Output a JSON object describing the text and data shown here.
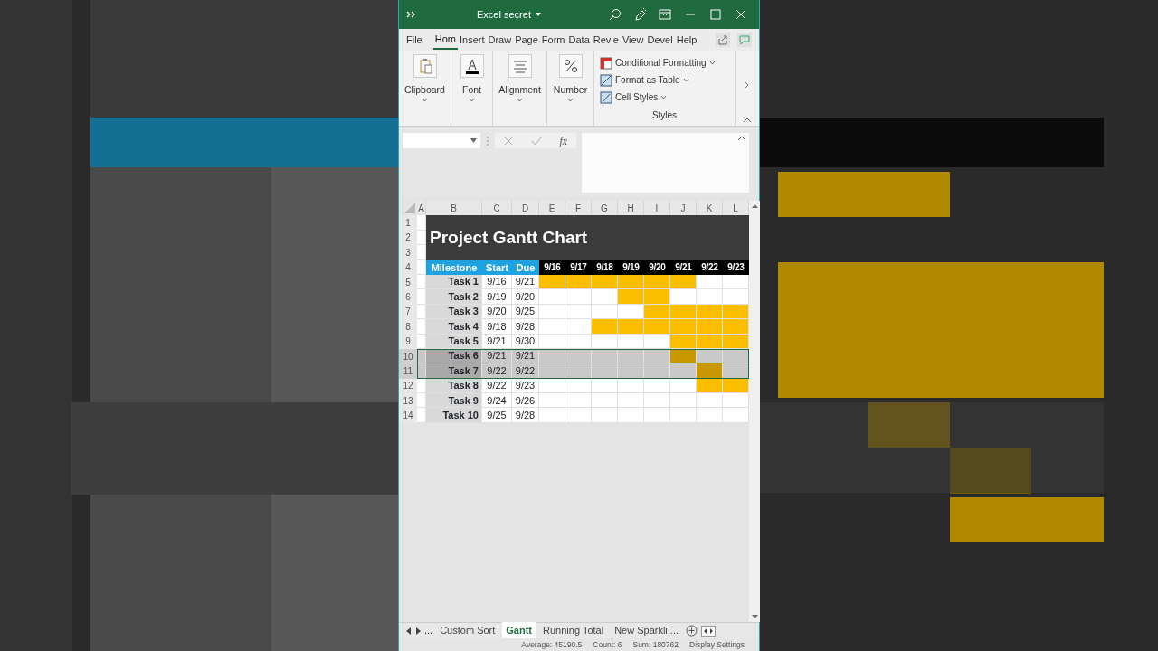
{
  "window": {
    "title": "Excel secret"
  },
  "menu_tabs": [
    {
      "label": "File",
      "selected": false
    },
    {
      "label": "Hom",
      "selected": true
    },
    {
      "label": "Insert",
      "selected": false
    },
    {
      "label": "Draw",
      "selected": false
    },
    {
      "label": "Page",
      "selected": false
    },
    {
      "label": "Form",
      "selected": false
    },
    {
      "label": "Data",
      "selected": false
    },
    {
      "label": "Revie",
      "selected": false
    },
    {
      "label": "View",
      "selected": false
    },
    {
      "label": "Devel",
      "selected": false
    },
    {
      "label": "Help",
      "selected": false
    }
  ],
  "ribbon_groups": [
    {
      "label": "Clipboard"
    },
    {
      "label": "Font"
    },
    {
      "label": "Alignment"
    },
    {
      "label": "Number"
    }
  ],
  "styles_group": {
    "label": "Styles",
    "items": [
      "Conditional Formatting",
      "Format as Table",
      "Cell Styles"
    ]
  },
  "formula_bar": {
    "function_label": "fx"
  },
  "sheet": {
    "column_headers": [
      "A",
      "B",
      "C",
      "D",
      "E",
      "F",
      "G",
      "H",
      "I",
      "J",
      "K",
      "L"
    ],
    "top_row_numbers": [
      "1",
      "2",
      "3",
      "4"
    ],
    "title": "Project Gantt Chart",
    "table_headers": [
      "Milestone",
      "Start",
      "Due"
    ],
    "dates": [
      "9/16",
      "9/17",
      "9/18",
      "9/19",
      "9/20",
      "9/21",
      "9/22",
      "9/23"
    ],
    "rows": [
      {
        "row_number": "5",
        "task": "Task 1",
        "start": "9/16",
        "due": "9/21",
        "selected": false,
        "bars": [
          true,
          true,
          true,
          true,
          true,
          true,
          false,
          false
        ]
      },
      {
        "row_number": "6",
        "task": "Task 2",
        "start": "9/19",
        "due": "9/20",
        "selected": false,
        "bars": [
          false,
          false,
          false,
          true,
          true,
          false,
          false,
          false
        ]
      },
      {
        "row_number": "7",
        "task": "Task 3",
        "start": "9/20",
        "due": "9/25",
        "selected": false,
        "bars": [
          false,
          false,
          false,
          false,
          true,
          true,
          true,
          true
        ]
      },
      {
        "row_number": "8",
        "task": "Task 4",
        "start": "9/18",
        "due": "9/28",
        "selected": false,
        "bars": [
          false,
          false,
          true,
          true,
          true,
          true,
          true,
          true
        ]
      },
      {
        "row_number": "9",
        "task": "Task 5",
        "start": "9/21",
        "due": "9/30",
        "selected": false,
        "bars": [
          false,
          false,
          false,
          false,
          false,
          true,
          true,
          true
        ]
      },
      {
        "row_number": "10",
        "task": "Task 6",
        "start": "9/21",
        "due": "9/21",
        "selected": true,
        "bars": [
          false,
          false,
          false,
          false,
          false,
          true,
          false,
          false
        ]
      },
      {
        "row_number": "11",
        "task": "Task 7",
        "start": "9/22",
        "due": "9/22",
        "selected": true,
        "bars": [
          false,
          false,
          false,
          false,
          false,
          false,
          true,
          false
        ]
      },
      {
        "row_number": "12",
        "task": "Task 8",
        "start": "9/22",
        "due": "9/23",
        "selected": false,
        "bars": [
          false,
          false,
          false,
          false,
          false,
          false,
          true,
          true
        ]
      },
      {
        "row_number": "13",
        "task": "Task 9",
        "start": "9/24",
        "due": "9/26",
        "selected": false,
        "bars": [
          false,
          false,
          false,
          false,
          false,
          false,
          false,
          false
        ]
      },
      {
        "row_number": "14",
        "task": "Task 10",
        "start": "9/25",
        "due": "9/28",
        "selected": false,
        "bars": [
          false,
          false,
          false,
          false,
          false,
          false,
          false,
          false
        ]
      }
    ]
  },
  "sheet_tabs": {
    "overflow": "...",
    "tabs": [
      {
        "label": "Custom Sort",
        "selected": false
      },
      {
        "label": "Gantt",
        "selected": true
      },
      {
        "label": "Running Total",
        "selected": false
      },
      {
        "label": "New Sparkli ...",
        "selected": false
      }
    ]
  },
  "status_bar": [
    "Average: 45190.5",
    "Count: 6",
    "Sum: 180762",
    "Display Settings"
  ]
}
